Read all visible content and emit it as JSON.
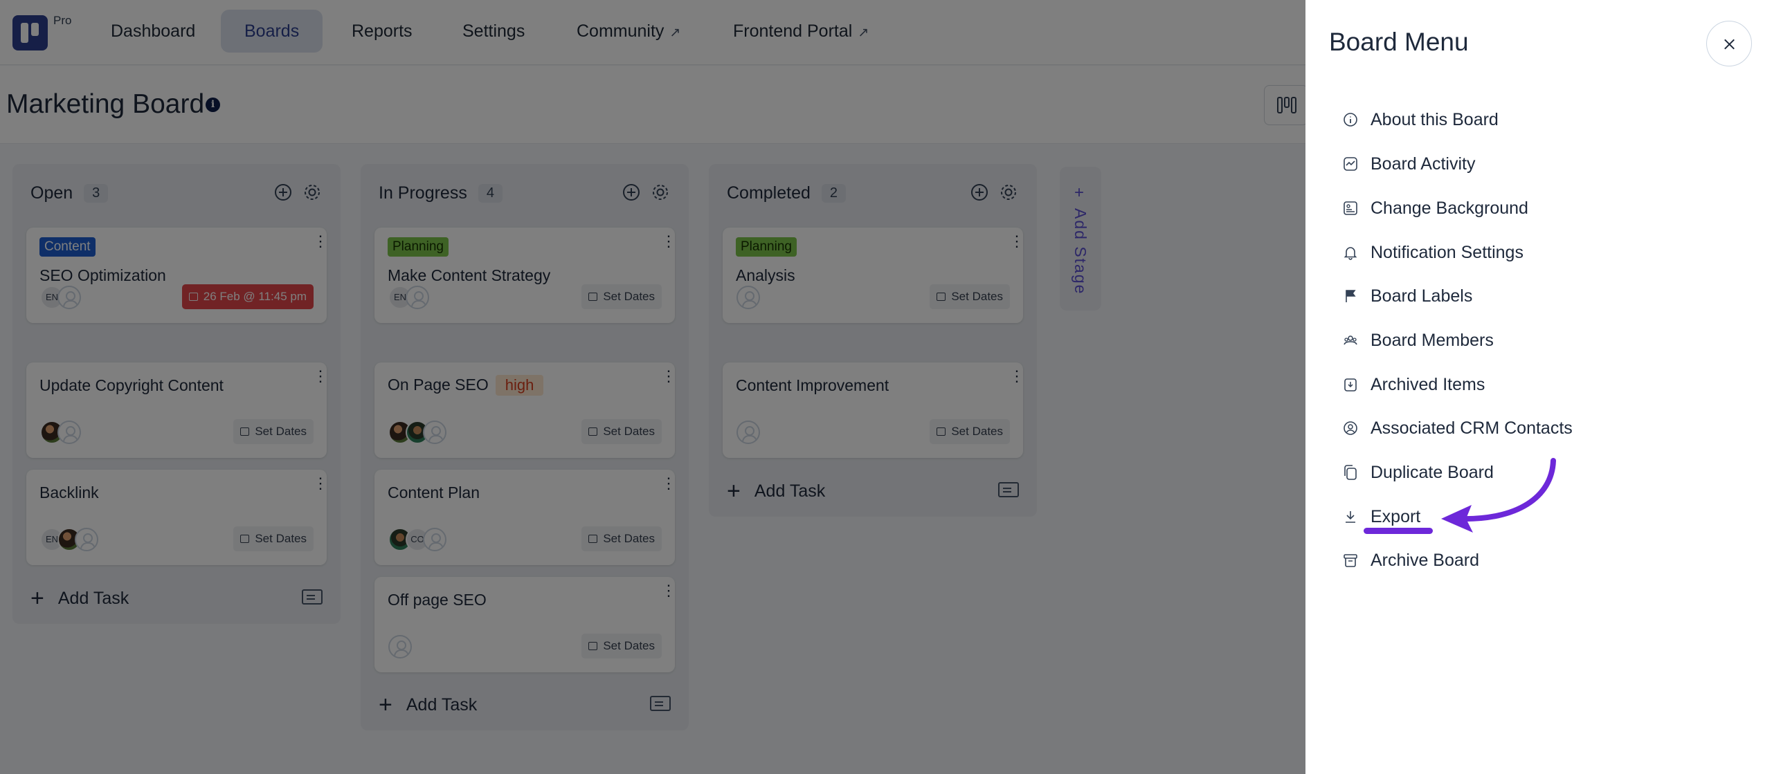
{
  "nav": {
    "pro_label": "Pro",
    "items": [
      {
        "label": "Dashboard"
      },
      {
        "label": "Boards"
      },
      {
        "label": "Reports"
      },
      {
        "label": "Settings"
      },
      {
        "label": "Community"
      },
      {
        "label": "Frontend Portal"
      }
    ],
    "active_item": "Boards"
  },
  "board": {
    "title": "Marketing Board",
    "info_icon": "i"
  },
  "stages": [
    {
      "title": "Open",
      "count": "3",
      "cards": [
        {
          "tag": "Content",
          "title": "SEO Optimization",
          "avatars": [
            "EN"
          ],
          "date": "26 Feb @ 11:45 pm"
        },
        {
          "title": "Update Copyright Content",
          "date": "Set Dates"
        },
        {
          "title": "Backlink",
          "avatars": [
            "EN"
          ],
          "date": "Set Dates"
        }
      ],
      "add_task": "Add Task"
    },
    {
      "title": "In Progress",
      "count": "4",
      "cards": [
        {
          "tag": "Planning",
          "title": "Make Content Strategy",
          "avatars": [
            "EN"
          ],
          "date": "Set Dates"
        },
        {
          "title": "On Page SEO",
          "priority": "high",
          "date": "Set Dates"
        },
        {
          "title": "Content Plan",
          "avatars": [
            "CO"
          ],
          "date": "Set Dates"
        },
        {
          "title": "Off page SEO",
          "date": "Set Dates"
        }
      ],
      "add_task": "Add Task"
    },
    {
      "title": "Completed",
      "count": "2",
      "cards": [
        {
          "tag": "Planning",
          "title": "Analysis",
          "date": "Set Dates"
        },
        {
          "title": "Content Improvement",
          "date": "Set Dates"
        }
      ],
      "add_task": "Add Task"
    }
  ],
  "add_stage": {
    "plus": "+",
    "label": "Add Stage"
  },
  "drawer": {
    "title": "Board Menu",
    "items": [
      {
        "label": "About this Board",
        "icon": "info-circle-icon"
      },
      {
        "label": "Board Activity",
        "icon": "activity-icon"
      },
      {
        "label": "Change Background",
        "icon": "background-icon"
      },
      {
        "label": "Notification Settings",
        "icon": "bell-icon"
      },
      {
        "label": "Board Labels",
        "icon": "flag-icon"
      },
      {
        "label": "Board Members",
        "icon": "members-icon"
      },
      {
        "label": "Archived Items",
        "icon": "archive-box-icon"
      },
      {
        "label": "Associated CRM Contacts",
        "icon": "user-circle-icon"
      },
      {
        "label": "Duplicate Board",
        "icon": "copy-icon"
      },
      {
        "label": "Export",
        "icon": "download-icon"
      },
      {
        "label": "Archive Board",
        "icon": "archive-icon"
      }
    ]
  },
  "colors": {
    "brand": "#2d3f8f",
    "annotation": "#6d28d9",
    "due_date": "#e2474a",
    "tag_content": "#1e5fd1",
    "tag_planning": "#7cc54a",
    "priority_high": "#d63f1f"
  }
}
